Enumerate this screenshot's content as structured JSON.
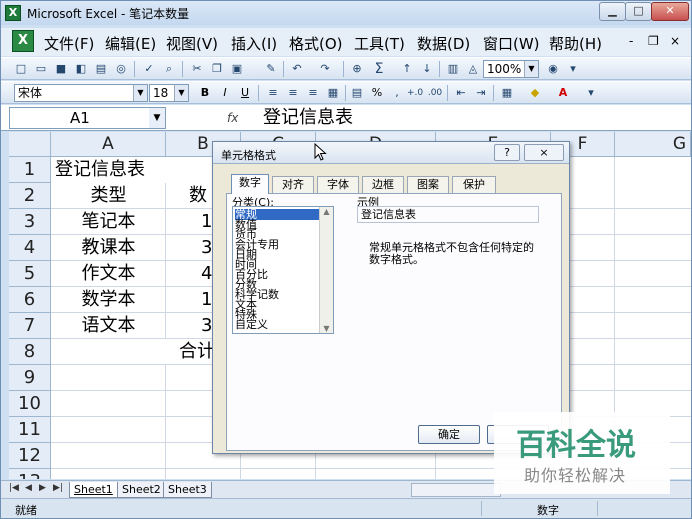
{
  "window": {
    "title": "Microsoft Excel - 笔记本数量",
    "app_icon": "X",
    "min_glyph": "▁",
    "max_glyph": "□",
    "close_glyph": "✕"
  },
  "menubar": {
    "icon_glyph": "X",
    "items": [
      "文件(F)",
      "编辑(E)",
      "视图(V)",
      "插入(I)",
      "格式(O)",
      "工具(T)",
      "数据(D)",
      "窗口(W)",
      "帮助(H)"
    ],
    "mdi_min": "-",
    "mdi_restore": "❐",
    "mdi_close": "×"
  },
  "toolbar_std": {
    "zoom": "100%",
    "sum_glyph": "Σ"
  },
  "toolbar_fmt": {
    "font_name": "宋体",
    "font_size": "18",
    "bold": "B",
    "italic": "I",
    "underline": "U",
    "percent": "%"
  },
  "formula_bar": {
    "name_box": "A1",
    "fx": "fx",
    "value": "登记信息表"
  },
  "grid": {
    "columns": [
      "A",
      "B",
      "C",
      "D",
      "E",
      "F",
      "G"
    ],
    "rows": [
      "1",
      "2",
      "3",
      "4",
      "5",
      "6",
      "7",
      "8",
      "9",
      "10",
      "11",
      "12",
      "13"
    ],
    "cells": {
      "a1": "登记信息表",
      "a2": "类型",
      "b2": "数",
      "a3": "笔记本",
      "b3": "1",
      "a4": "教课本",
      "b4": "3",
      "a5": "作文本",
      "b5": "4",
      "a6": "数学本",
      "b6": "1",
      "a7": "语文本",
      "b7": "3",
      "b8": "合计"
    }
  },
  "dialog": {
    "title": "单元格格式",
    "help_glyph": "?",
    "close_glyph": "×",
    "tabs": [
      "数字",
      "对齐",
      "字体",
      "边框",
      "图案",
      "保护"
    ],
    "category_label": "分类(C):",
    "categories": [
      "常规",
      "数值",
      "货币",
      "会计专用",
      "日期",
      "时间",
      "百分比",
      "分数",
      "科学记数",
      "文本",
      "特殊",
      "自定义"
    ],
    "sample_label": "示例",
    "sample_value": "登记信息表",
    "description": "常规单元格格式不包含任何特定的数字格式。",
    "ok_label": "确定",
    "cancel_label": ""
  },
  "sheets": {
    "nav": [
      "|◀",
      "◀",
      "▶",
      "▶|"
    ],
    "tabs": [
      "Sheet1",
      "Sheet2",
      "Sheet3"
    ]
  },
  "status": {
    "left": "就绪",
    "right": "数字"
  },
  "watermark": {
    "title": "百科全说",
    "subtitle": "助你轻松解决"
  }
}
